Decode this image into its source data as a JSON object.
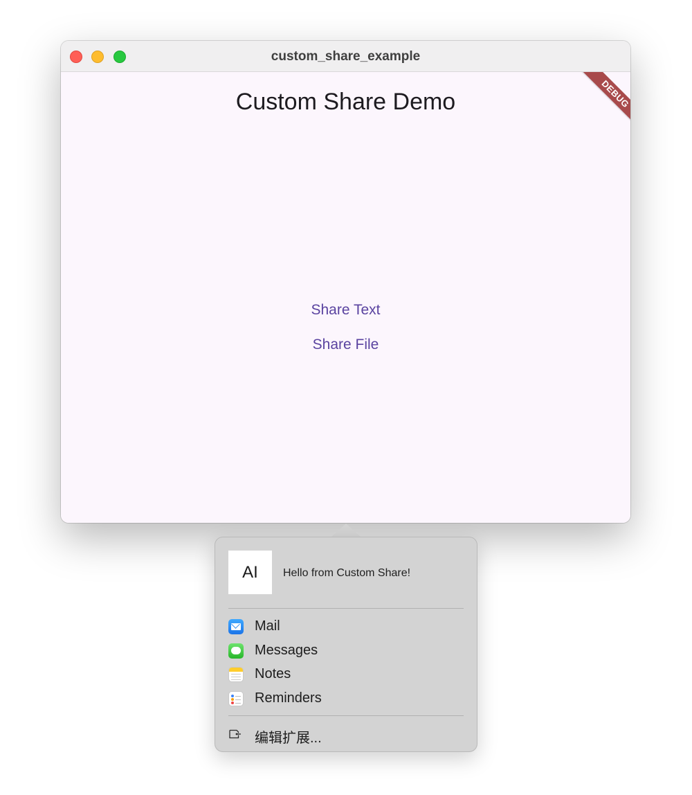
{
  "window": {
    "title": "custom_share_example"
  },
  "app": {
    "title": "Custom Share Demo",
    "debug_banner": "DEBUG",
    "buttons": {
      "share_text": "Share Text",
      "share_file": "Share File"
    }
  },
  "share_popover": {
    "preview_glyph": "AI",
    "preview_text": "Hello from Custom Share!",
    "items": [
      {
        "label": "Mail",
        "icon": "mail-icon"
      },
      {
        "label": "Messages",
        "icon": "messages-icon"
      },
      {
        "label": "Notes",
        "icon": "notes-icon"
      },
      {
        "label": "Reminders",
        "icon": "reminders-icon"
      }
    ],
    "edit_extensions": "编辑扩展..."
  },
  "colors": {
    "accent": "#5a43a0",
    "debug_banner": "#a84a4b",
    "window_background": "#fcf6fd",
    "popover_background": "#d3d3d3"
  }
}
